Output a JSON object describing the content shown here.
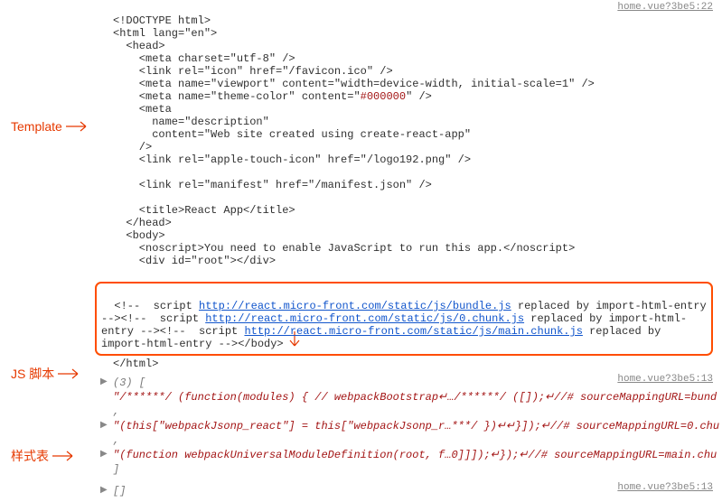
{
  "annotations": {
    "template": "Template",
    "js": "JS 脚本",
    "styles": "样式表"
  },
  "sourceLinks": {
    "entry1": "home.vue?3be5:22",
    "entry2": "home.vue?3be5:13",
    "entry3": "home.vue?3be5:13"
  },
  "html": {
    "l1": "<!DOCTYPE html>",
    "l2": "<html lang=\"en\">",
    "l3": "  <head>",
    "l4": "    <meta charset=\"utf-8\" />",
    "l5": "    <link rel=\"icon\" href=\"/favicon.ico\" />",
    "l6": "    <meta name=\"viewport\" content=\"width=device-width, initial-scale=1\" />",
    "l7a": "    <meta name=\"theme-color\" content=\"",
    "l7b": "#000000",
    "l7c": "\" />",
    "l8": "    <meta",
    "l9": "      name=\"description\"",
    "l10": "      content=\"Web site created using create-react-app\"",
    "l11": "    />",
    "l12": "    <link rel=\"apple-touch-icon\" href=\"/logo192.png\" />",
    "l13": "    ",
    "l14": "    <link rel=\"manifest\" href=\"/manifest.json\" />",
    "l15": "    ",
    "l16": "    <title>React App</title>",
    "l17": "  </head>",
    "l18": "  <body>",
    "l19": "    <noscript>You need to enable JavaScript to run this app.</noscript>",
    "l20": "    <div id=\"root\"></div>",
    "l21": "    "
  },
  "highlight": {
    "seg1a": "  <!--  script ",
    "seg1_url": "http://react.micro-front.com/static/js/bundle.js",
    "seg1b": " replaced by import-html-entry --><!--  script ",
    "seg2_url": "http://react.micro-front.com/static/js/0.chunk.js",
    "seg2b": " replaced by import-html-entry --><!--  script ",
    "seg3_url": "http://react.micro-front.com/static/js/main.chunk.js",
    "seg3b": " replaced by import-html-entry --></body>"
  },
  "htmlEnd": "</html>",
  "jsArray": {
    "header": "(3) [",
    "l1a": "\"/******/ (function(modules) { // webpackBootstrap↵…/******/ ([]);↵//# sourceMappingURL=bund",
    "l1b": ",",
    "l2a": "\"(this[\"webpackJsonp_react\"] = this[\"webpackJsonp_r…***/ })↵↵}]);↵//# sourceMappingURL=0.chu",
    "l2b": ",",
    "l3a": "\"(function webpackUniversalModuleDefinition(root, f…0]]]);↵});↵//# sourceMappingURL=main.chu",
    "footer": "]"
  },
  "stylesArray": "[]"
}
